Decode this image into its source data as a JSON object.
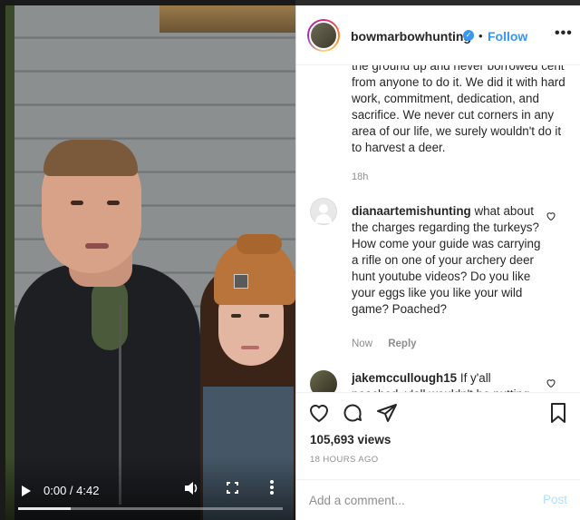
{
  "header": {
    "username": "bowmarbowhunting",
    "separator": "•",
    "follow_label": "Follow",
    "options": "•••"
  },
  "caption": {
    "text": "the ground up and never borrowed cent from anyone to do it. We did it with hard work, commitment, dedication, and sacrifice. We never cut corners in any area of our life, we surely wouldn't do it to harvest a deer.",
    "time": "18h"
  },
  "comments": [
    {
      "username": "dianaartemishunting",
      "text": "what about the charges regarding the turkeys? How come your guide was carrying a rifle on one of your archery deer hunt youtube videos? Do you like your eggs like you like your wild game? Poached?",
      "time": "Now",
      "reply_label": "Reply"
    },
    {
      "username": "jakemccullough15",
      "text": "If y'all poached, y'all wouldn't be putting"
    }
  ],
  "actions": {
    "views": "105,693 views",
    "posted": "18 HOURS AGO"
  },
  "add_comment": {
    "placeholder": "Add a comment...",
    "post_label": "Post"
  },
  "video": {
    "time": "0:00 / 4:42",
    "progress_buffered": 0.2
  },
  "colors": {
    "accent": "#3897f0",
    "post_disabled": "#b2dffc"
  }
}
